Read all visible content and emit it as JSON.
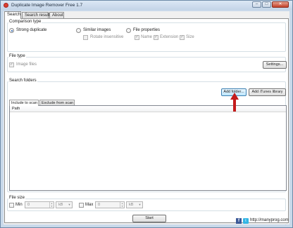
{
  "window": {
    "title": "Duplicate Image Remover Free 1.7",
    "minimize": "–",
    "maximize": "□",
    "close": "✕"
  },
  "tabs": [
    "Search",
    "Search result",
    "About"
  ],
  "comparison": {
    "group_label": "Comparison type",
    "strong": "Strong duplicate",
    "similar": "Similar images",
    "rotate": "Rotate insensitive",
    "file_props": "File properties",
    "name": "Name",
    "extension": "Extension",
    "size": "Size"
  },
  "file_type": {
    "group_label": "File type",
    "image_files": "Image files",
    "settings": "Settings..."
  },
  "search_folders": {
    "group_label": "Search folders",
    "add_folder": "Add folder...",
    "add_itunes": "Add iTunes library",
    "tab_include": "Include to scan",
    "tab_exclude": "Exclude from scan",
    "path_header": "Path"
  },
  "file_size": {
    "group_label": "File size",
    "min_label": "Min",
    "min_value": "0",
    "min_unit": "kB",
    "max_label": "Max",
    "max_value": "0",
    "max_unit": "kB"
  },
  "start": "Start",
  "status": {
    "facebook": "f",
    "twitter": "t",
    "website": "http://manyprog.com"
  },
  "colors": {
    "accent_arrow": "#c41b1b",
    "selection": "#1b5cb3"
  }
}
